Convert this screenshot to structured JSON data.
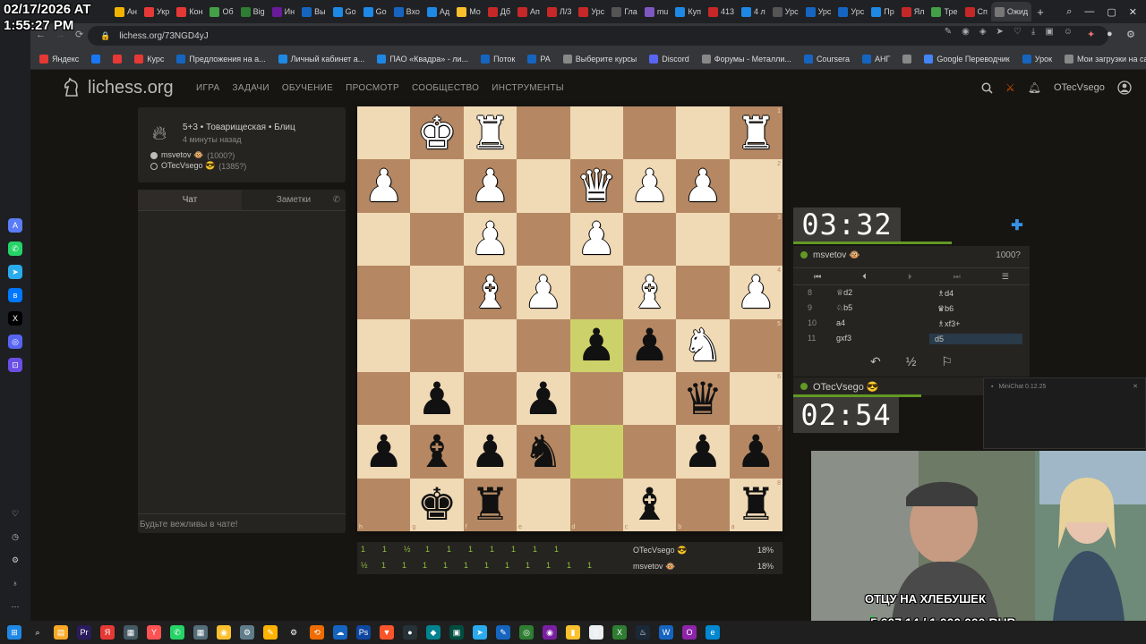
{
  "overlay": {
    "timestamp_line1": "02/17/2026 AT",
    "timestamp_line2": "1:55:27 PM"
  },
  "browser": {
    "url": "lichess.org/73NGD4yJ",
    "tabs": [
      {
        "label": "Ан",
        "color": "#f0b400"
      },
      {
        "label": "Укр",
        "color": "#e53935"
      },
      {
        "label": "Кон",
        "color": "#e53935"
      },
      {
        "label": "Об",
        "color": "#43a047"
      },
      {
        "label": "Big",
        "color": "#2e7d32"
      },
      {
        "label": "Ин",
        "color": "#6a1b9a"
      },
      {
        "label": "Вы",
        "color": "#1565c0"
      },
      {
        "label": "Go",
        "color": "#1e88e5"
      },
      {
        "label": "Go",
        "color": "#1e88e5"
      },
      {
        "label": "Вхо",
        "color": "#1565c0"
      },
      {
        "label": "Ад",
        "color": "#1e88e5"
      },
      {
        "label": "Мо",
        "color": "#fbc02d"
      },
      {
        "label": "Дб",
        "color": "#c62828"
      },
      {
        "label": "Ап",
        "color": "#c62828"
      },
      {
        "label": "Л/3",
        "color": "#c62828"
      },
      {
        "label": "Урс",
        "color": "#c62828"
      },
      {
        "label": "Гла",
        "color": "#555555"
      },
      {
        "label": "mu",
        "color": "#7e57c2"
      },
      {
        "label": "Куп",
        "color": "#1e88e5"
      },
      {
        "label": "413",
        "color": "#c62828"
      },
      {
        "label": "4 л",
        "color": "#1e88e5"
      },
      {
        "label": "Урс",
        "color": "#555555"
      },
      {
        "label": "Урс",
        "color": "#1565c0"
      },
      {
        "label": "Урс",
        "color": "#1565c0"
      },
      {
        "label": "Пр",
        "color": "#1e88e5"
      },
      {
        "label": "Ял",
        "color": "#c62828"
      },
      {
        "label": "Тре",
        "color": "#43a047"
      },
      {
        "label": "Сп",
        "color": "#c62828"
      },
      {
        "label": "Ожид",
        "color": "#777777",
        "active": true
      }
    ],
    "bookmarks": [
      {
        "label": "Яндекс",
        "color": "#e53935"
      },
      {
        "label": "",
        "color": "#1877f2"
      },
      {
        "label": "",
        "color": "#e53935"
      },
      {
        "label": "Курс",
        "color": "#e53935"
      },
      {
        "label": "Предложения на а...",
        "color": "#1565c0"
      },
      {
        "label": "Личный кабинет а...",
        "color": "#1e88e5"
      },
      {
        "label": "ПАО «Квадра» - ли...",
        "color": "#1e88e5"
      },
      {
        "label": "Поток",
        "color": "#1565c0"
      },
      {
        "label": "РА",
        "color": "#1565c0"
      },
      {
        "label": "Выберите курсы",
        "color": "#888888"
      },
      {
        "label": "Discord",
        "color": "#5865f2"
      },
      {
        "label": "Форумы - Металли...",
        "color": "#888888"
      },
      {
        "label": "Coursera",
        "color": "#1565c0"
      },
      {
        "label": "АНГ",
        "color": "#1565c0"
      },
      {
        "label": "",
        "color": "#888888"
      },
      {
        "label": "Google Переводчик",
        "color": "#4285f4"
      },
      {
        "label": "Урок",
        "color": "#1565c0"
      },
      {
        "label": "Мои загрузки на са...",
        "color": "#888888"
      }
    ]
  },
  "site": {
    "logo": "lichess.org",
    "nav": [
      "ИГРА",
      "ЗАДАЧИ",
      "ОБУЧЕНИЕ",
      "ПРОСМОТР",
      "СООБЩЕСТВО",
      "ИНСТРУМЕНТЫ"
    ],
    "username": "OTecVsego"
  },
  "game": {
    "title": "5+3 • Товарищеская • Блиц",
    "time_ago": "4 минуты назад",
    "player_white": "msvetov 🐵",
    "player_white_rating": "(1000?)",
    "player_black": "OTecVsego 😎",
    "player_black_rating": "(1385?)"
  },
  "chat": {
    "tab_chat": "Чат",
    "tab_notes": "Заметки",
    "placeholder": "Будьте вежливы в чате!"
  },
  "board": {
    "rows": [
      [
        {
          "p": ""
        },
        {
          "p": "♚",
          "c": "w"
        },
        {
          "p": "♜",
          "c": "w"
        },
        {
          "p": ""
        },
        {
          "p": ""
        },
        {
          "p": ""
        },
        {
          "p": ""
        },
        {
          "p": "♜",
          "c": "w"
        }
      ],
      [
        {
          "p": "♟",
          "c": "w"
        },
        {
          "p": ""
        },
        {
          "p": "♟",
          "c": "w"
        },
        {
          "p": ""
        },
        {
          "p": "♛",
          "c": "w"
        },
        {
          "p": "♟",
          "c": "w"
        },
        {
          "p": "♟",
          "c": "w"
        },
        {
          "p": ""
        }
      ],
      [
        {
          "p": ""
        },
        {
          "p": ""
        },
        {
          "p": "♟",
          "c": "w"
        },
        {
          "p": ""
        },
        {
          "p": "♟",
          "c": "w"
        },
        {
          "p": ""
        },
        {
          "p": ""
        },
        {
          "p": ""
        }
      ],
      [
        {
          "p": ""
        },
        {
          "p": ""
        },
        {
          "p": "♝",
          "c": "w"
        },
        {
          "p": "♟",
          "c": "w"
        },
        {
          "p": ""
        },
        {
          "p": "♝",
          "c": "w"
        },
        {
          "p": ""
        },
        {
          "p": "♟",
          "c": "w"
        }
      ],
      [
        {
          "p": ""
        },
        {
          "p": ""
        },
        {
          "p": ""
        },
        {
          "p": ""
        },
        {
          "p": "♟",
          "c": "b",
          "h": 1
        },
        {
          "p": "♟",
          "c": "b"
        },
        {
          "p": "♞",
          "c": "w"
        },
        {
          "p": ""
        }
      ],
      [
        {
          "p": ""
        },
        {
          "p": "♟",
          "c": "b"
        },
        {
          "p": ""
        },
        {
          "p": "♟",
          "c": "b"
        },
        {
          "p": ""
        },
        {
          "p": ""
        },
        {
          "p": "♛",
          "c": "b"
        },
        {
          "p": ""
        }
      ],
      [
        {
          "p": "♟",
          "c": "b"
        },
        {
          "p": "♝",
          "c": "b"
        },
        {
          "p": "♟",
          "c": "b"
        },
        {
          "p": "♞",
          "c": "b"
        },
        {
          "p": "",
          "h": 1
        },
        {
          "p": ""
        },
        {
          "p": "♟",
          "c": "b"
        },
        {
          "p": "♟",
          "c": "b"
        }
      ],
      [
        {
          "p": ""
        },
        {
          "p": "♚",
          "c": "b"
        },
        {
          "p": "♜",
          "c": "b"
        },
        {
          "p": ""
        },
        {
          "p": ""
        },
        {
          "p": "♝",
          "c": "b"
        },
        {
          "p": ""
        },
        {
          "p": "♜",
          "c": "b"
        }
      ]
    ],
    "rank_labels": [
      "1",
      "2",
      "3",
      "4",
      "5",
      "6",
      "7",
      "8"
    ],
    "file_labels": [
      "h",
      "g",
      "f",
      "e",
      "d",
      "c",
      "b",
      "a"
    ]
  },
  "crosstable": {
    "row1_name": "OTecVsego 😎",
    "row1_pct": "18%",
    "row2_name": "msvetov 🐵",
    "row2_pct": "18%",
    "row1_scores": [
      "1",
      "1",
      "½",
      "1",
      "1",
      "1",
      "1",
      "1",
      "1",
      "1"
    ],
    "row2_scores": [
      "½",
      "1",
      "1",
      "1",
      "1",
      "1",
      "1",
      "1",
      "1",
      "1",
      "1",
      "1"
    ]
  },
  "clocks": {
    "top": "03:32",
    "bottom": "02:54",
    "top_remaining": 0.68,
    "bottom_remaining": 0.55
  },
  "opponent": {
    "name": "msvetov 🐵",
    "rating": "1000?"
  },
  "me": {
    "name": "OTecVsego 😎"
  },
  "moves": [
    {
      "n": "8",
      "w": "♕d2",
      "b": "♗d4"
    },
    {
      "n": "9",
      "w": "♘b5",
      "b": "♛b6"
    },
    {
      "n": "10",
      "w": "a4",
      "b": "♗xf3+"
    },
    {
      "n": "11",
      "w": "gxf3",
      "b": "d5"
    }
  ],
  "actions": {
    "takeback": "↶",
    "draw": "½",
    "resign": "⚐"
  },
  "minichat": {
    "title": "MiniChat 0.12.25"
  },
  "stream": {
    "donate_label": "ОТЦУ НА ХЛЕБУШЕК",
    "donate_amount": "5 607.14 / 1 000 000 RUB",
    "donate_progress": 0.0056
  }
}
